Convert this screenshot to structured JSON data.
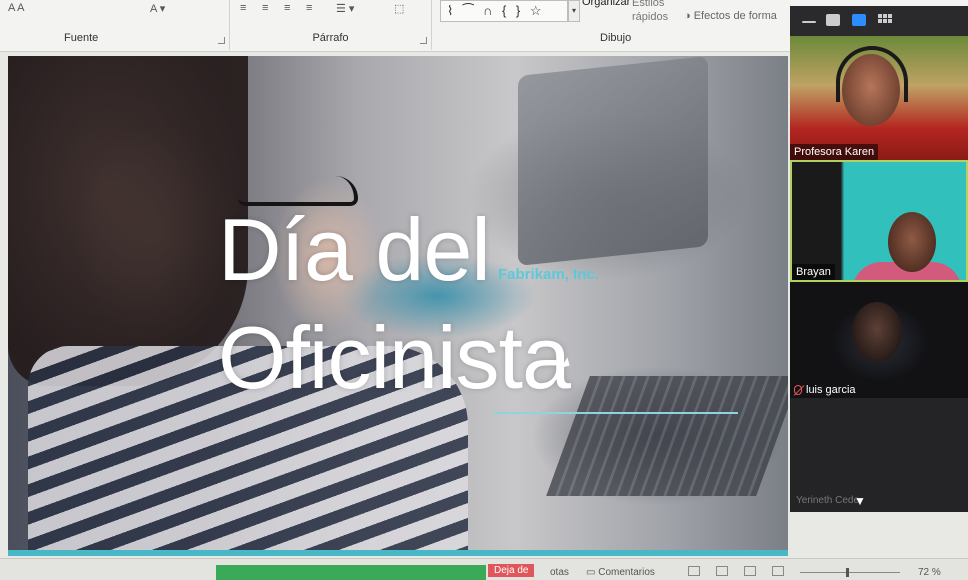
{
  "ribbon": {
    "groups": [
      {
        "label": "Fuente"
      },
      {
        "label": "Párrafo"
      },
      {
        "label": "Dibujo"
      }
    ],
    "shapes_gallery": "⌇ ⁀ ∩ { } ☆",
    "arrange_label": "Organizar",
    "quick_styles_label": "Estilos rápidos",
    "shape_effects_label": "Efectos de forma"
  },
  "slide": {
    "title_line1": "Día del",
    "title_line2": "Oficinista",
    "company": "Fabrikam, Inc.",
    "accent_color": "#49b8c6"
  },
  "video_panel": {
    "participants": [
      {
        "name": "Profesora Karen",
        "muted": false
      },
      {
        "name": "Brayan",
        "muted": false
      },
      {
        "name": "luis garcia",
        "muted": true
      },
      {
        "name": "Yerineth Cede",
        "muted": false
      }
    ],
    "active_speaker_color": "#b0d060"
  },
  "statusbar": {
    "stop_label": "Deja de",
    "notes_label": "otas",
    "comments_label": "Comentarios",
    "zoom": "72 %"
  }
}
